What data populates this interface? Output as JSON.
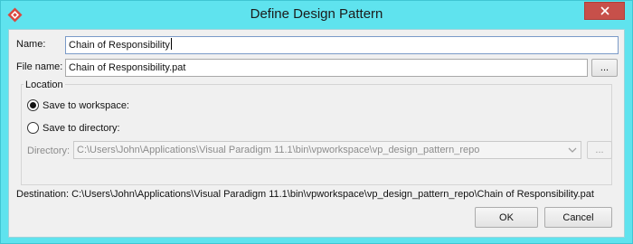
{
  "window": {
    "title": "Define Design Pattern"
  },
  "form": {
    "name_label": "Name:",
    "name_value": "Chain of Responsibility",
    "file_name_label": "File name:",
    "file_name_value": "Chain of Responsibility.pat",
    "browse_label": "..."
  },
  "location": {
    "group_title": "Location",
    "save_workspace_label": "Save to workspace:",
    "save_workspace_selected": true,
    "save_directory_label": "Save to directory:",
    "save_directory_selected": false,
    "directory_label": "Directory:",
    "directory_value": "C:\\Users\\John\\Applications\\Visual Paradigm 11.1\\bin\\vpworkspace\\vp_design_pattern_repo",
    "directory_browse_label": "..."
  },
  "destination": {
    "text": "Destination: C:\\Users\\John\\Applications\\Visual Paradigm 11.1\\bin\\vpworkspace\\vp_design_pattern_repo\\Chain of Responsibility.pat"
  },
  "buttons": {
    "ok_label": "OK",
    "cancel_label": "Cancel"
  },
  "icons": {
    "app": "visual-paradigm-logo-icon",
    "close": "close-icon",
    "combo_arrow": "chevron-down-icon"
  },
  "colors": {
    "title_bar": "#5fe3ee",
    "close_button": "#c7504a",
    "dialog_background": "#f0f0f0",
    "app_icon": "#d9473f"
  }
}
